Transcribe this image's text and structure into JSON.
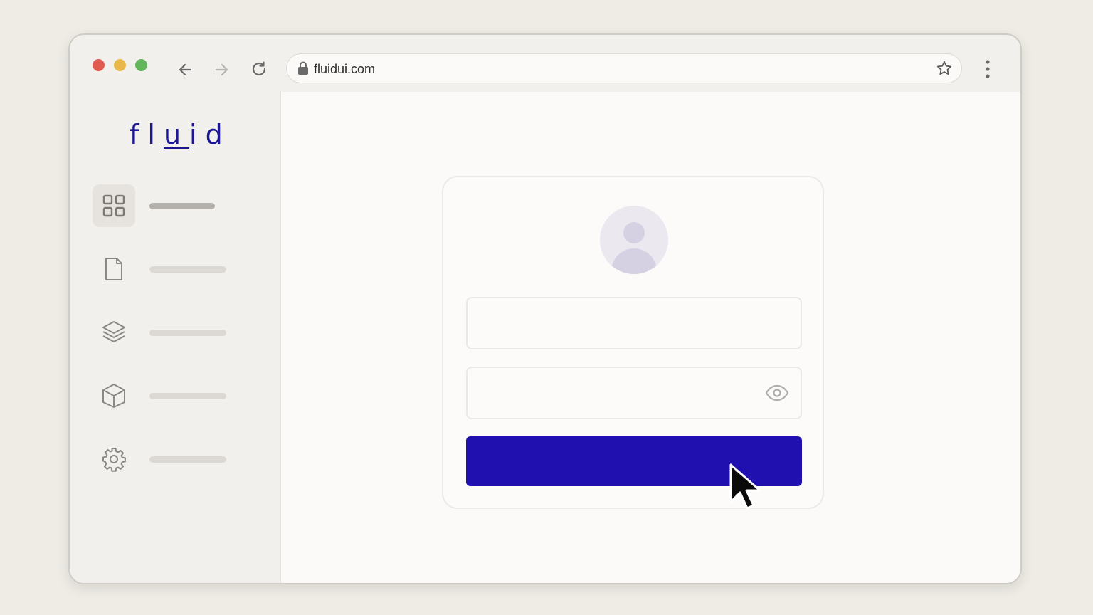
{
  "browser": {
    "url": "fluidui.com",
    "controls": [
      "back-icon",
      "forward-icon",
      "reload-icon",
      "lock-icon",
      "star-icon",
      "kebab-menu-icon"
    ]
  },
  "sidebar": {
    "logo": "fluid",
    "items": [
      {
        "icon": "grid-icon",
        "active": true
      },
      {
        "icon": "document-icon",
        "active": false
      },
      {
        "icon": "layers-icon",
        "active": false
      },
      {
        "icon": "cube-icon",
        "active": false
      },
      {
        "icon": "gear-icon",
        "active": false
      }
    ]
  },
  "login": {
    "avatar_icon": "user-avatar-icon",
    "password_toggle_icon": "eye-icon"
  },
  "colors": {
    "brand": "#1e1794",
    "button": "#2110b0",
    "close_dot": "#e25b51",
    "minimize_dot": "#e8b84a",
    "maximize_dot": "#62b65b"
  }
}
